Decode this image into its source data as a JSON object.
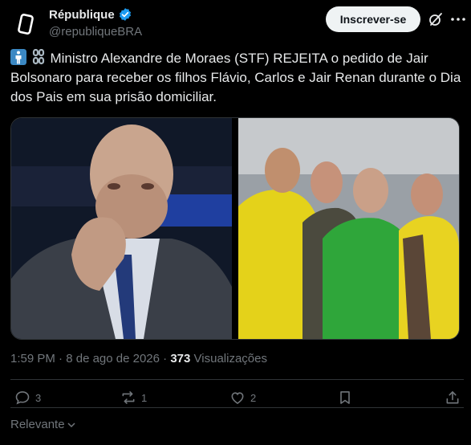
{
  "author": {
    "display_name": "République",
    "handle": "@republiqueBRA"
  },
  "header": {
    "subscribe_label": "Inscrever-se"
  },
  "tweet": {
    "text": "Ministro Alexandre de Moraes (STF) REJEITA o pedido de Jair Bolsonaro para receber os filhos Flávio, Carlos e Jair Renan durante o Dia dos Pais em sua prisão domiciliar.",
    "emojis": [
      "person-standing-icon",
      "chain-links-icon"
    ],
    "time": "1:59 PM",
    "separator": "·",
    "date": "8 de ago de 2026",
    "views_count": "373",
    "views_label": "Visualizações"
  },
  "actions": {
    "replies": "3",
    "reposts": "1",
    "likes": "2"
  },
  "footer": {
    "sort_label": "Relevante"
  },
  "colors": {
    "background": "#000000",
    "text": "#e7e9ea",
    "muted": "#71767b",
    "verified": "#1d9bf0",
    "subscribe_bg": "#eff3f4"
  }
}
